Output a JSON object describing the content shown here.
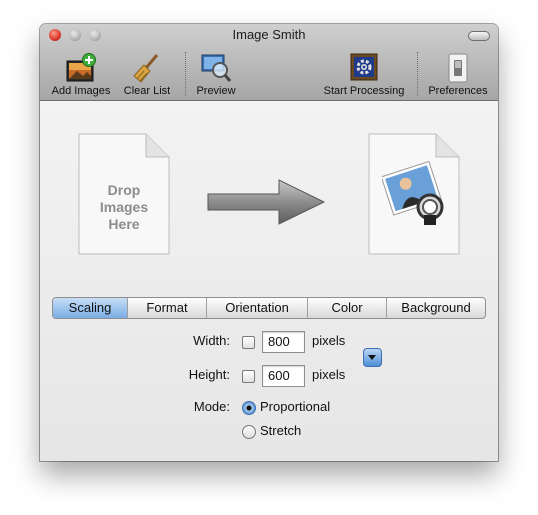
{
  "window": {
    "title": "Image Smith"
  },
  "toolbar": {
    "items": [
      {
        "label": "Add Images",
        "icon": "add-images-icon"
      },
      {
        "label": "Clear List",
        "icon": "broom-icon"
      },
      {
        "label": "Preview",
        "icon": "preview-magnifier-icon"
      },
      {
        "label": "Start Processing",
        "icon": "gear-icon"
      },
      {
        "label": "Preferences",
        "icon": "switch-icon"
      }
    ]
  },
  "drop_zone": {
    "text_line1": "Drop",
    "text_line2": "Images",
    "text_line3": "Here"
  },
  "tabs": [
    "Scaling",
    "Format",
    "Orientation",
    "Color",
    "Background"
  ],
  "active_tab": "Scaling",
  "scaling": {
    "width_label": "Width:",
    "width_checked": false,
    "width_value": "800",
    "width_unit": "pixels",
    "height_label": "Height:",
    "height_checked": false,
    "height_value": "600",
    "height_unit": "pixels",
    "mode_label": "Mode:",
    "mode_options": [
      "Proportional",
      "Stretch"
    ],
    "mode_selected": "Proportional"
  },
  "colors": {
    "accent": "#5c96d8",
    "active_tab": "#7aaee6"
  }
}
